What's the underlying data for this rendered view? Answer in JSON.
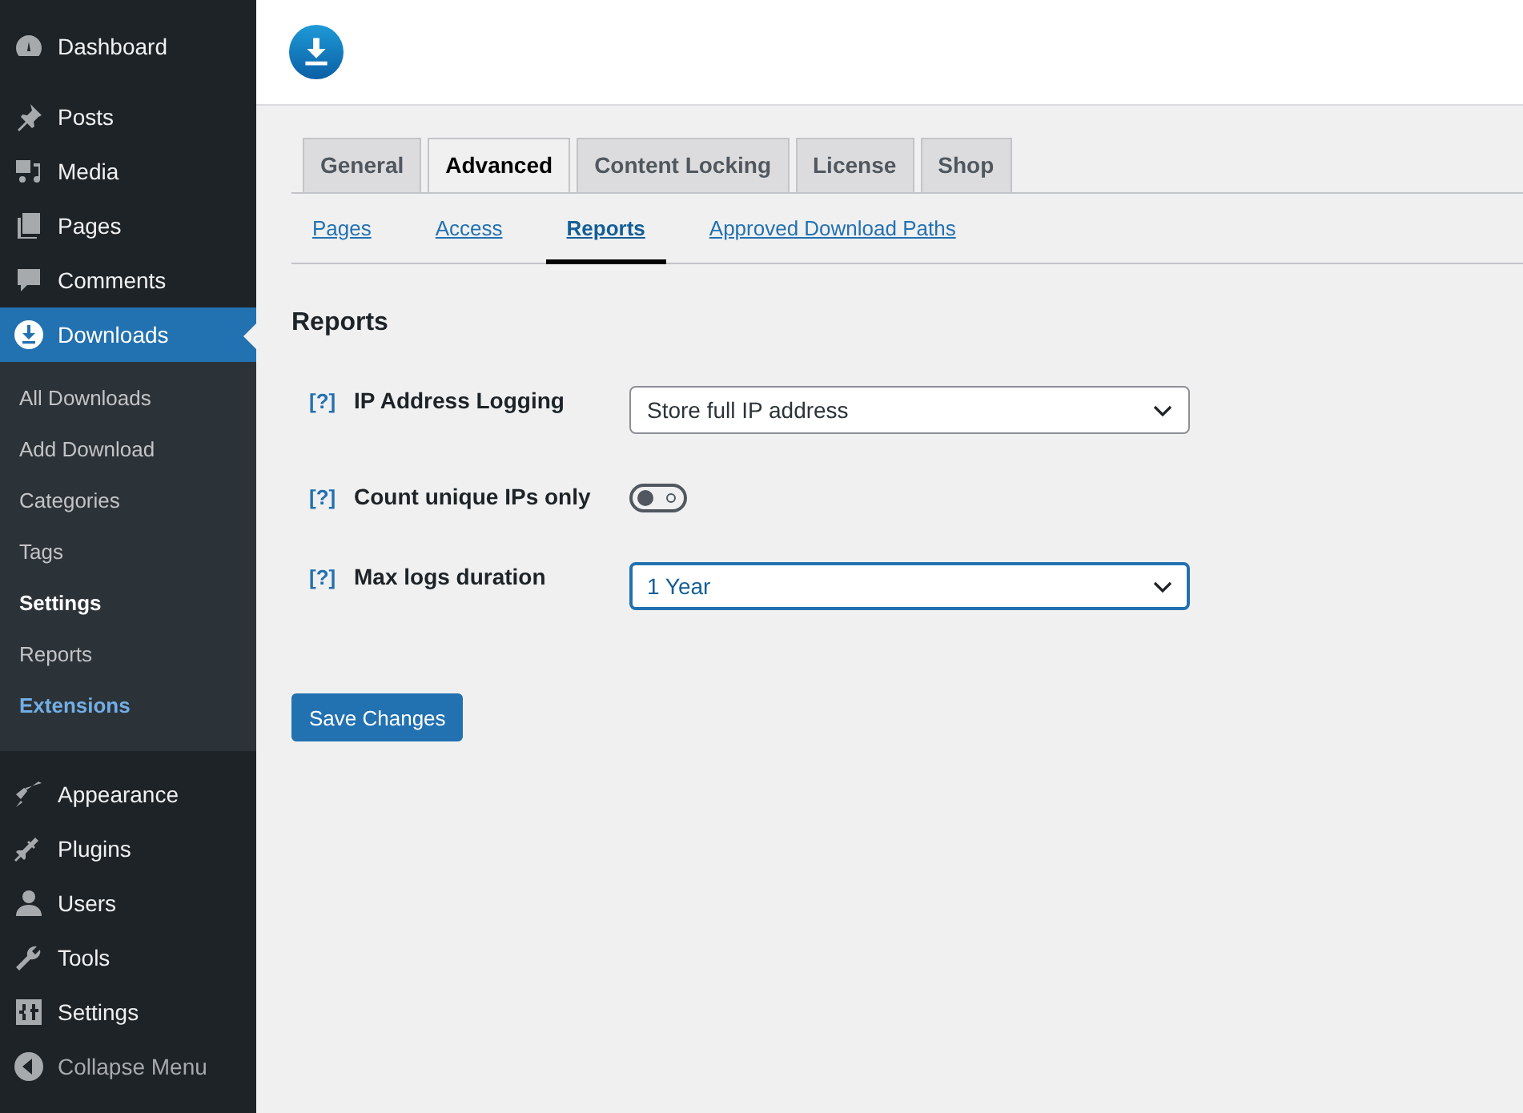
{
  "sidebar": {
    "items": [
      {
        "label": "Dashboard",
        "selected": false
      },
      {
        "label": "Posts",
        "selected": false
      },
      {
        "label": "Media",
        "selected": false
      },
      {
        "label": "Pages",
        "selected": false
      },
      {
        "label": "Comments",
        "selected": false
      },
      {
        "label": "Downloads",
        "selected": true,
        "children": [
          {
            "label": "All Downloads",
            "selected": false,
            "highlighted": false
          },
          {
            "label": "Add Download",
            "selected": false,
            "highlighted": false
          },
          {
            "label": "Categories",
            "selected": false,
            "highlighted": false
          },
          {
            "label": "Tags",
            "selected": false,
            "highlighted": false
          },
          {
            "label": "Settings",
            "selected": true,
            "highlighted": false
          },
          {
            "label": "Reports",
            "selected": false,
            "highlighted": false
          },
          {
            "label": "Extensions",
            "selected": false,
            "highlighted": true
          }
        ]
      },
      {
        "label": "Appearance",
        "selected": false
      },
      {
        "label": "Plugins",
        "selected": false
      },
      {
        "label": "Users",
        "selected": false
      },
      {
        "label": "Tools",
        "selected": false
      },
      {
        "label": "Settings",
        "selected": false
      }
    ],
    "collapse": "Collapse Menu"
  },
  "tabs": [
    {
      "label": "General",
      "selected": false
    },
    {
      "label": "Advanced",
      "selected": true
    },
    {
      "label": "Content Locking",
      "selected": false
    },
    {
      "label": "License",
      "selected": false
    },
    {
      "label": "Shop",
      "selected": false
    }
  ],
  "subtabs": [
    {
      "label": "Pages",
      "selected": false
    },
    {
      "label": "Access",
      "selected": false
    },
    {
      "label": "Reports",
      "selected": true
    },
    {
      "label": "Approved Download Paths",
      "selected": false
    }
  ],
  "section_title": "Reports",
  "settings": [
    {
      "kind": "select",
      "help": "[?]",
      "label": "IP Address Logging",
      "value": "Store full IP address",
      "focused": false
    },
    {
      "kind": "toggle",
      "help": "[?]",
      "label": "Count unique IPs only",
      "on": false
    },
    {
      "kind": "select",
      "help": "[?]",
      "label": "Max logs duration",
      "value": "1 Year",
      "focused": true
    }
  ],
  "save_button": "Save Changes"
}
